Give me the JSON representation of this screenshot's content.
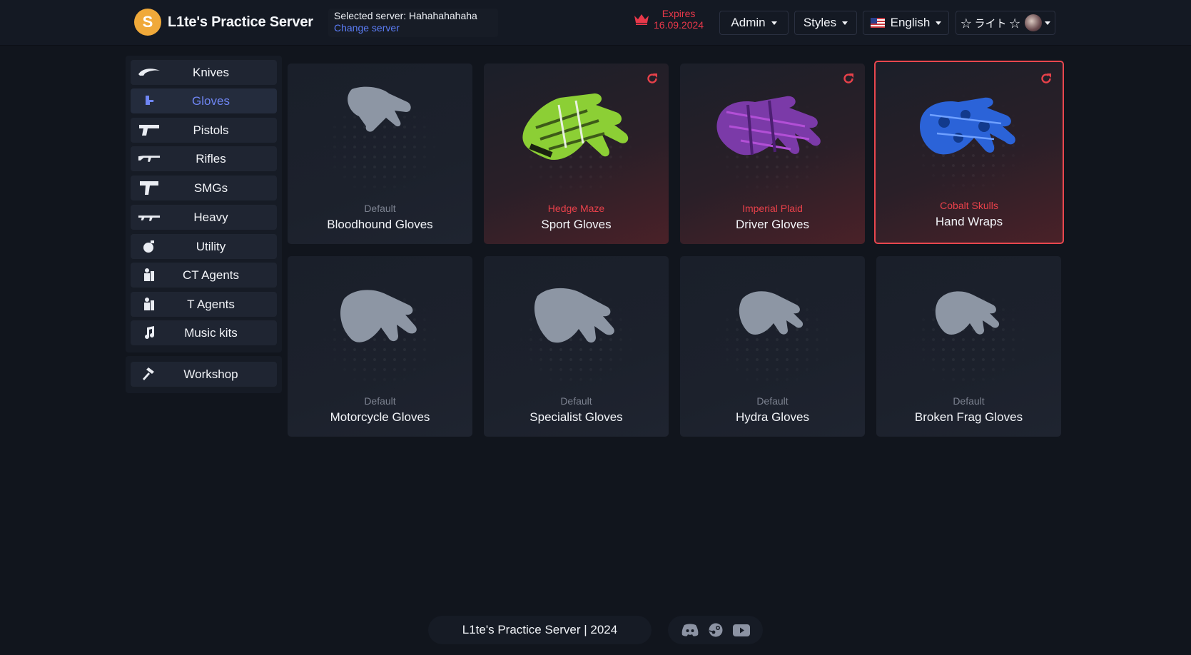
{
  "header": {
    "logo_letter": "S",
    "brand_name": "L1te's Practice Server",
    "selected_server": "Selected server: Hahahahahaha",
    "change_server": "Change server",
    "expires_label": "Expires",
    "expires_date": "16.09.2024",
    "admin_label": "Admin",
    "styles_label": "Styles",
    "language_label": "English",
    "user_name": "☆ ライト ☆",
    "accent_color": "#e8384a"
  },
  "sidebar": {
    "items": [
      {
        "label": "Knives",
        "icon": "knife-icon"
      },
      {
        "label": "Gloves",
        "icon": "glove-icon",
        "active": true
      },
      {
        "label": "Pistols",
        "icon": "pistol-icon"
      },
      {
        "label": "Rifles",
        "icon": "rifle-icon"
      },
      {
        "label": "SMGs",
        "icon": "smg-icon"
      },
      {
        "label": "Heavy",
        "icon": "heavy-icon"
      },
      {
        "label": "Utility",
        "icon": "grenade-icon"
      },
      {
        "label": "CT Agents",
        "icon": "agent-icon"
      },
      {
        "label": "T Agents",
        "icon": "agent-icon"
      },
      {
        "label": "Music kits",
        "icon": "music-icon"
      }
    ],
    "workshop": {
      "label": "Workshop",
      "icon": "hammer-icon"
    }
  },
  "cards": [
    {
      "skin": "Default",
      "name": "Bloodhound Gloves",
      "equipped": false
    },
    {
      "skin": "Hedge Maze",
      "name": "Sport Gloves",
      "equipped": true
    },
    {
      "skin": "Imperial Plaid",
      "name": "Driver Gloves",
      "equipped": true
    },
    {
      "skin": "Cobalt Skulls",
      "name": "Hand Wraps",
      "equipped": true,
      "selected": true
    },
    {
      "skin": "Default",
      "name": "Motorcycle Gloves",
      "equipped": false
    },
    {
      "skin": "Default",
      "name": "Specialist Gloves",
      "equipped": false
    },
    {
      "skin": "Default",
      "name": "Hydra Gloves",
      "equipped": false
    },
    {
      "skin": "Default",
      "name": "Broken Frag Gloves",
      "equipped": false
    }
  ],
  "footer": {
    "text": "L1te's Practice Server | 2024",
    "social": [
      "discord-icon",
      "steam-icon",
      "youtube-icon"
    ]
  }
}
